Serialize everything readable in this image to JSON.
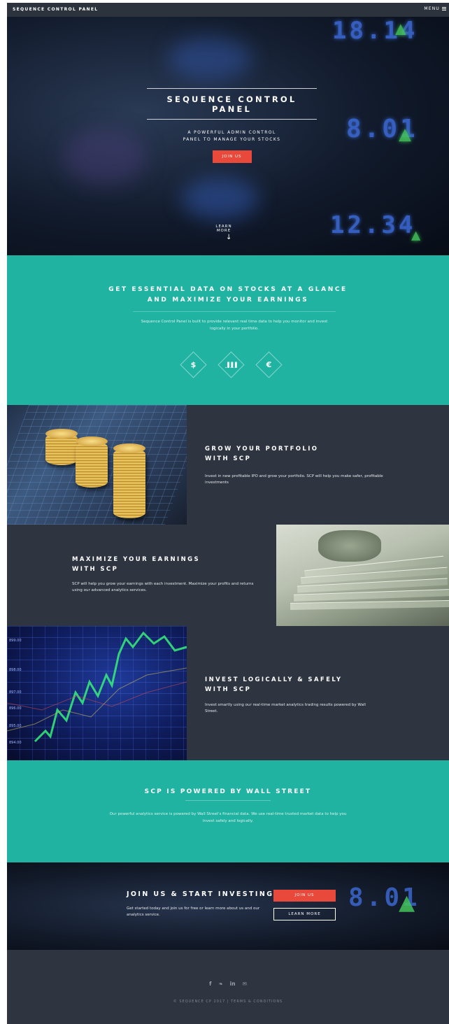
{
  "header": {
    "brand": "SEQUENCE CONTROL PANEL",
    "menu_label": "MENU"
  },
  "hero": {
    "title": "SEQUENCE CONTROL PANEL",
    "subtitle": "A POWERFUL ADMIN CONTROL PANEL TO MANAGE YOUR STOCKS",
    "join_label": "JOIN US",
    "learn_more_label": "LEARN MORE",
    "ticker_top": "18.14",
    "ticker_mid": "8.01",
    "ticker_bottom": "12.34"
  },
  "intro": {
    "heading": "GET ESSENTIAL DATA ON STOCKS AT A GLANCE AND MAXIMIZE YOUR EARNINGS",
    "text": "Sequence Control Panel is built to provide relevant real time data to help you monitor and invest logically in your portfolio.",
    "icons": [
      {
        "name": "dollar-icon",
        "glyph": "$"
      },
      {
        "name": "bar-chart-icon",
        "glyph": "▐▐▐"
      },
      {
        "name": "euro-icon",
        "glyph": "€"
      }
    ]
  },
  "features": [
    {
      "heading": "GROW YOUR PORTFOLIO WITH SCP",
      "text": "Invest in new profitable IPO and grow your portfolio. SCP will help you make safer, profitable investments"
    },
    {
      "heading": "MAXIMIZE YOUR EARNINGS WITH SCP",
      "text": "SCP will help you grow your earnings with each investment. Maximize your profits and returns using our advanced analytics services."
    },
    {
      "heading": "INVEST LOGICALLY & SAFELY WITH SCP",
      "text": "Invest smartly using our real-time market analytics trading results powered by Wall Street."
    }
  ],
  "chart_image": {
    "ticks": [
      "899.00",
      "898.00",
      "897.00",
      "896.00",
      "895.00",
      "894.00"
    ]
  },
  "powered": {
    "heading": "SCP IS POWERED BY WALL STREET",
    "text": "Our powerful analytics service is powered by Wall Street's financial data. We use real-time trusted market data to help you invest safely and logically."
  },
  "cta": {
    "heading": "JOIN US & START INVESTING",
    "text": "Get started today and join us for free or learn more about us and our analytics service.",
    "join_label": "JOIN US",
    "learn_label": "LEARN MORE"
  },
  "footer": {
    "social": [
      {
        "name": "facebook-icon",
        "glyph": "f"
      },
      {
        "name": "twitter-icon",
        "glyph": "❧"
      },
      {
        "name": "linkedin-icon",
        "glyph": "in"
      },
      {
        "name": "email-icon",
        "glyph": "✉"
      }
    ],
    "copyright": "© SEQUENCE CP 2017 | TERMS & CONDITIONS"
  },
  "colors": {
    "teal": "#21b3a2",
    "dark": "#2e3440",
    "accent": "#e8493a"
  }
}
